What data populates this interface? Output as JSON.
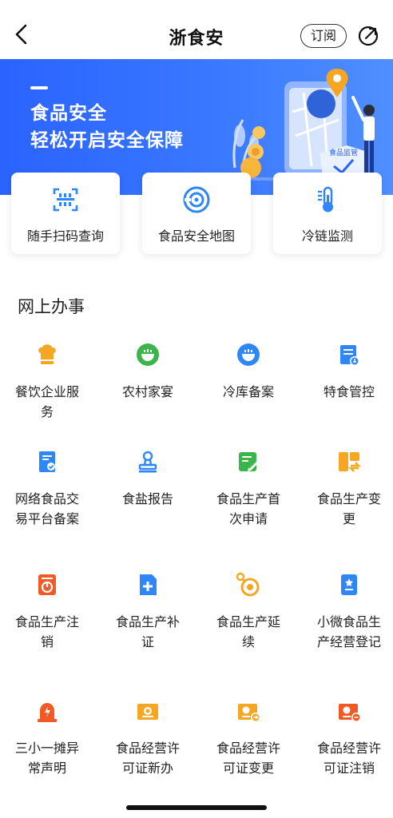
{
  "navbar": {
    "title": "浙食安",
    "subscribe_label": "订阅"
  },
  "banner": {
    "line1": "食品安全",
    "line2": "轻松开启安全保障",
    "badge_text": "食品监管"
  },
  "quick_cards": [
    {
      "label": "随手扫码查询",
      "icon": "qr-scan-icon"
    },
    {
      "label": "食品安全地图",
      "icon": "map-target-icon"
    },
    {
      "label": "冷链监测",
      "icon": "thermometer-icon"
    }
  ],
  "section": {
    "title": "网上办事"
  },
  "services": [
    {
      "label": "餐饮企业服务",
      "icon": "chef-hat-icon"
    },
    {
      "label": "农村家宴",
      "icon": "bowl-icon"
    },
    {
      "label": "冷库备案",
      "icon": "bowl-blue-icon"
    },
    {
      "label": "特食管控",
      "icon": "clipboard-icon"
    },
    {
      "label": "网络食品交易平台备案",
      "icon": "shield-doc-icon"
    },
    {
      "label": "食盐报告",
      "icon": "stamp-icon"
    },
    {
      "label": "食品生产首次申请",
      "icon": "edit-doc-icon"
    },
    {
      "label": "食品生产变更",
      "icon": "swap-icon"
    },
    {
      "label": "食品生产注销",
      "icon": "power-doc-icon"
    },
    {
      "label": "食品生产补证",
      "icon": "add-doc-icon"
    },
    {
      "label": "食品生产延续",
      "icon": "circle-target-icon"
    },
    {
      "label": "小微食品生产经营登记",
      "icon": "badge-doc-icon"
    },
    {
      "label": "三小一摊异常声明",
      "icon": "alarm-light-icon"
    },
    {
      "label": "食品经营许可证新办",
      "icon": "license-new-icon"
    },
    {
      "label": "食品经营许可证变更",
      "icon": "license-change-icon"
    },
    {
      "label": "食品经营许可证注销",
      "icon": "license-cancel-icon"
    }
  ],
  "colors": {
    "primary_blue": "#2a63ff",
    "orange": "#f5a623",
    "red_orange": "#f15a24",
    "green": "#3ab54a",
    "light_blue": "#2f86f6"
  }
}
